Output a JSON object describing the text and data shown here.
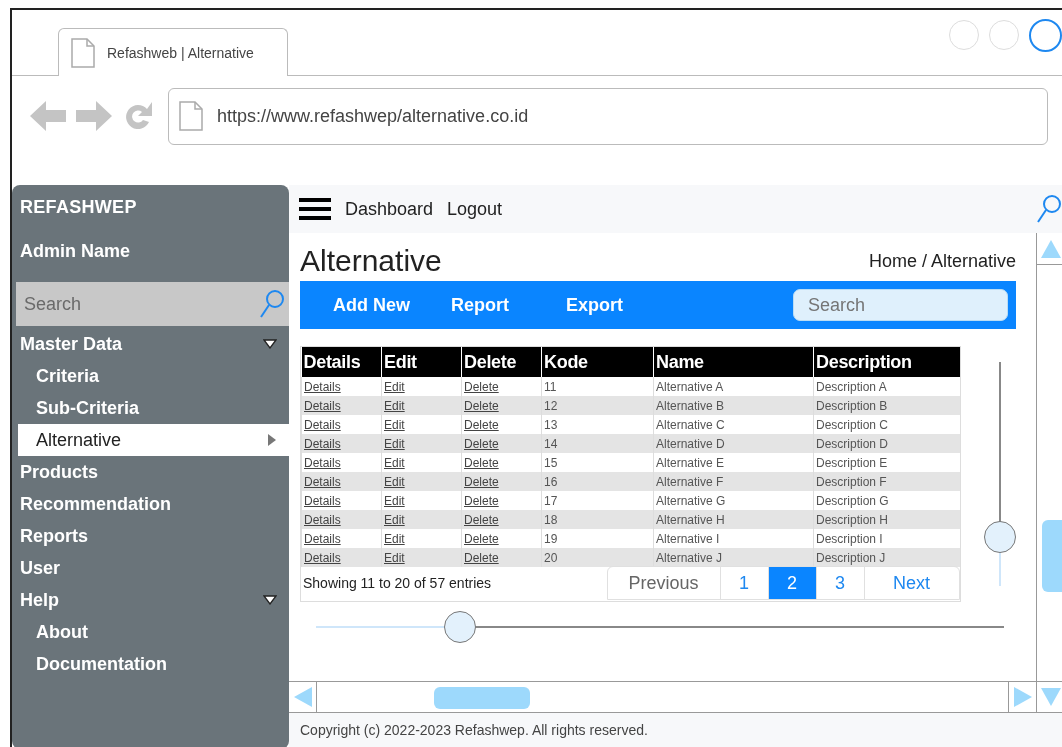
{
  "browser": {
    "tab_title": "Refashweb | Alternative",
    "url": "https://www.refashwep/alternative.co.id"
  },
  "sidebar": {
    "brand": "REFASHWEP",
    "user": "Admin Name",
    "search": {
      "placeholder": "Search"
    },
    "items": [
      {
        "label": "Master Data",
        "selected": false,
        "expanded": true,
        "children": [
          {
            "label": "Criteria",
            "selected": false
          },
          {
            "label": "Sub-Criteria",
            "selected": false
          },
          {
            "label": "Alternative",
            "selected": true
          }
        ]
      },
      {
        "label": "Products",
        "selected": false
      },
      {
        "label": "Recommendation",
        "selected": false
      },
      {
        "label": "Reports",
        "selected": false
      },
      {
        "label": "User",
        "selected": false
      },
      {
        "label": "Help",
        "selected": false,
        "expanded": true,
        "children": [
          {
            "label": "About",
            "selected": false
          },
          {
            "label": "Documentation",
            "selected": false
          }
        ]
      }
    ]
  },
  "topbar": {
    "links": [
      "Dashboard",
      "Logout"
    ]
  },
  "page": {
    "title": "Alternative",
    "breadcrumb": "Home / Alternative"
  },
  "toolbar": {
    "buttons": [
      "Add New",
      "Report",
      "Export"
    ],
    "search": {
      "placeholder": "Search"
    }
  },
  "table": {
    "columns": [
      "Details",
      "Edit",
      "Delete",
      "Kode",
      "Name",
      "Description"
    ],
    "rows": [
      [
        "Details",
        "Edit",
        "Delete",
        "11",
        "Alternative A",
        "Description A"
      ],
      [
        "Details",
        "Edit",
        "Delete",
        "12",
        "Alternative B",
        "Description B"
      ],
      [
        "Details",
        "Edit",
        "Delete",
        "13",
        "Alternative C",
        "Description C"
      ],
      [
        "Details",
        "Edit",
        "Delete",
        "14",
        "Alternative D",
        "Description D"
      ],
      [
        "Details",
        "Edit",
        "Delete",
        "15",
        "Alternative E",
        "Description E"
      ],
      [
        "Details",
        "Edit",
        "Delete",
        "16",
        "Alternative F",
        "Description F"
      ],
      [
        "Details",
        "Edit",
        "Delete",
        "17",
        "Alternative G",
        "Description G"
      ],
      [
        "Details",
        "Edit",
        "Delete",
        "18",
        "Alternative H",
        "Description H"
      ],
      [
        "Details",
        "Edit",
        "Delete",
        "19",
        "Alternative I",
        "Description I"
      ],
      [
        "Details",
        "Edit",
        "Delete",
        "20",
        "Alternative J",
        "Description J"
      ]
    ]
  },
  "pagination": {
    "info": "Showing 11 to 20 of 57 entries",
    "previous": "Previous",
    "pages": [
      {
        "label": "1",
        "selected": false
      },
      {
        "label": "2",
        "selected": true
      },
      {
        "label": "3",
        "selected": false
      }
    ],
    "next": "Next"
  },
  "sliders": [
    {
      "kind": "vertical",
      "level": 0.22
    },
    {
      "kind": "horizontal",
      "level": 0.21
    }
  ],
  "footer": "Copyright (c) 2022-2023 Refashwep. All rights reserved."
}
